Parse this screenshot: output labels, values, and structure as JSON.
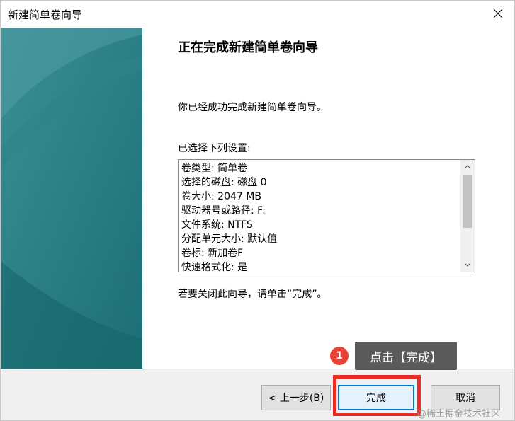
{
  "window": {
    "title": "新建简单卷向导",
    "close_icon": "close-icon"
  },
  "main": {
    "heading": "正在完成新建简单卷向导",
    "success_text": "你已经成功完成新建简单卷向导。",
    "settings_label": "已选择下列设置:",
    "settings": [
      "卷类型: 简单卷",
      "选择的磁盘: 磁盘 0",
      "卷大小: 2047 MB",
      "驱动器号或路径: F:",
      "文件系统: NTFS",
      "分配单元大小: 默认值",
      "卷标: 新加卷F",
      "快速格式化: 是"
    ],
    "close_hint": "若要关闭此向导，请单击“完成”。"
  },
  "footer": {
    "back_label": "< 上一步(B)",
    "finish_label": "完成",
    "cancel_label": "取消"
  },
  "annotation": {
    "step_number": "1",
    "callout_text": "点击【完成】",
    "highlight_color": "#ee2a24"
  },
  "watermark": "@稀土掘金技术社区",
  "colors": {
    "banner": "#217a7e",
    "accent": "#0078d7"
  }
}
